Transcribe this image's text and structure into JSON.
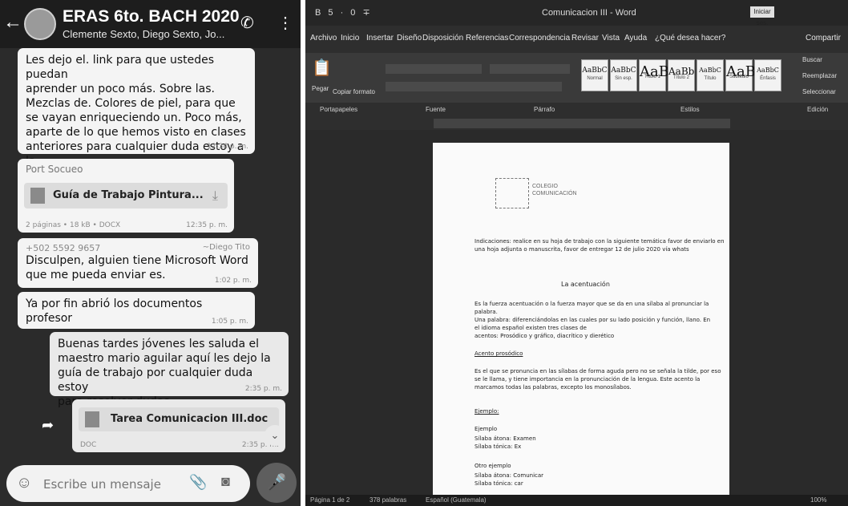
{
  "whatsapp": {
    "header": {
      "title": "ERAS 6to. BACH 2020",
      "subtitle": "Clemente Sexto, Diego Sexto, Jo..."
    },
    "messages": {
      "m1": {
        "text": "Les dejo el. link para que ustedes puedan\naprender un poco más. Sobre las.\nMezclas de. Colores de piel, para que\nse vayan enriqueciendo un. Poco más,\naparte de lo que hemos visto en clases\nanteriores para cualquier duda estoy a la\norden",
        "time": "12:34 p. m."
      },
      "m2": {
        "forwarded_label": "Port Socueo",
        "file_name": "Guía de Trabajo Pintura...",
        "meta": "2 páginas • 18 kB • DOCX",
        "time": "12:35 p. m."
      },
      "m3": {
        "sender": "+502 5592 9657",
        "sender_name": "~Diego Tito",
        "text": "Disculpen, alguien tiene Microsoft Word\nque me pueda enviar es.",
        "time": "1:02 p. m."
      },
      "m4": {
        "text": "Ya por fin abrió los documentos profesor",
        "time": "1:05 p. m."
      },
      "m5": {
        "text": "Buenas tardes jóvenes les saluda el\nmaestro mario aguilar aquí les dejo la\nguía de trabajo por cualquier duda estoy\npara resolver dudas",
        "time": "2:35 p. m."
      },
      "m6": {
        "file_name": "Tarea Comunicacion III.doc",
        "meta": "DOC",
        "time": "2:35 p. m."
      }
    },
    "composer": {
      "placeholder": "Escribe un mensaje"
    }
  },
  "word": {
    "title": "Comunicacion III - Word",
    "signin": "Iniciar ses.",
    "quick_access": "B 5 · 0 ∓",
    "menu": [
      "Archivo",
      "Inicio",
      "Insertar",
      "Diseño",
      "Disposición",
      "Referencias",
      "Correspondencia",
      "Revisar",
      "Vista",
      "Ayuda",
      "¿Qué desea hacer?",
      "Compartir"
    ],
    "styles": [
      {
        "preview": "AaBbC",
        "name": "Normal"
      },
      {
        "preview": "AaBbC",
        "name": "Sin esp."
      },
      {
        "preview": "AaB",
        "name": "Título 1"
      },
      {
        "preview": "AaBb",
        "name": "Título 2"
      },
      {
        "preview": "AaBbC",
        "name": "Título"
      },
      {
        "preview": "AaB",
        "name": "Subtítulo"
      },
      {
        "preview": "AaBbC",
        "name": "Énfasis"
      }
    ],
    "editing": [
      "Buscar",
      "Reemplazar",
      "Seleccionar"
    ],
    "group_labels": [
      "Portapapeles",
      "Fuente",
      "Párrafo",
      "Estilos",
      "Edición"
    ],
    "paste_label": "Pegar",
    "format_painter": "Copiar formato",
    "page": {
      "header_text": "COLEGIO\nCOMUNICACIÓN",
      "intro": "Indicaciones: realice en su hoja de trabajo con la siguiente temática favor de enviarlo en\nuna hoja adjunta o manuscrita, favor de entregar 12 de julio 2020 vía whats",
      "section_title": "La acentuación",
      "p1": "Es la fuerza acentuación o la fuerza mayor que se da en una sílaba al pronunciar la palabra.\nUna palabra: diferenciándolas en las cuales por su lado posición y función, llano. En\nel idioma español existen tres clases de\nacentos: Prosódico y gráfico, diacrítico y dierético",
      "h2": "Acento prosódico",
      "p2": "Es el que se pronuncia en las sílabas de forma aguda pero no se señala la tilde, por eso\nse le llama, y tiene importancia en la pronunciación de la lengua. Este acento la\nmarcamos todas las palabras, excepto los monosílabos.",
      "h3": "Ejemplo:",
      "list1": "Ejemplo",
      "list2": "Sílaba átona: Examen\nSílaba tónica: Ex",
      "list3": "Otro ejemplo",
      "list4": "Sílaba átona: Comunicar\nSílaba tónica: car"
    },
    "statusbar": {
      "page": "Página 1 de 2",
      "words": "378 palabras",
      "lang": "Español (Guatemala)",
      "zoom": "100%"
    }
  }
}
